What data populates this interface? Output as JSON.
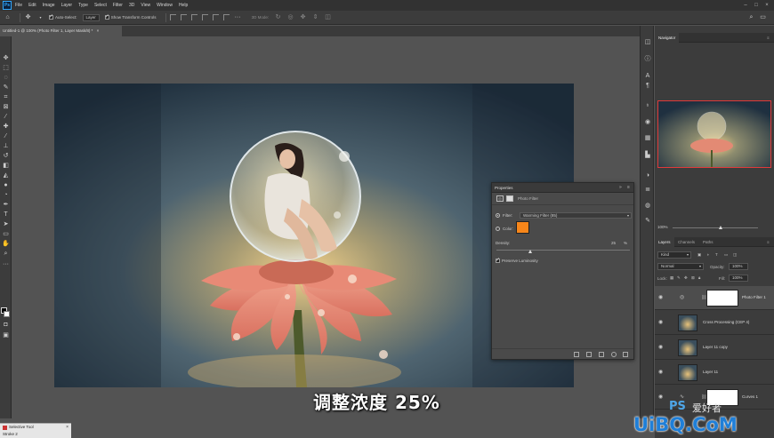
{
  "app": {
    "logo": "Ps",
    "menu": [
      "File",
      "Edit",
      "Image",
      "Layer",
      "Type",
      "Select",
      "Filter",
      "3D",
      "View",
      "Window",
      "Help"
    ]
  },
  "options_bar": {
    "auto_select_label": "Auto-Select:",
    "auto_select_value": "Layer",
    "transform_controls_label": "Show Transform Controls",
    "mode_3d_label": "3D Mode:"
  },
  "document_tab": {
    "title": "Untitled-1 @ 100% (Photo Filter 1, Layer Mask/8) *",
    "close": "×"
  },
  "subtitle": "调整浓度 25%",
  "properties": {
    "title": "Properties",
    "header_icons": "»",
    "menu_icon": "≡",
    "type_label": "Photo Filter",
    "filter_label": "Filter:",
    "filter_value": "Warming Filter (85)",
    "color_label": "Color:",
    "color_value": "#f7861a",
    "density_label": "Density:",
    "density_value": "25",
    "density_unit": "%",
    "density_fraction": 0.25,
    "preserve_label": "Preserve Luminosity",
    "preserve_checked": true,
    "filter_selected": true
  },
  "navigator": {
    "tab": "Navigator",
    "zoom": "100%"
  },
  "layers_panel": {
    "tabs": [
      "Layers",
      "Channels",
      "Paths"
    ],
    "kind_label": "Kind",
    "blend_mode": "Normal",
    "opacity_label": "Opacity:",
    "opacity_value": "100%",
    "lock_label": "Lock:",
    "fill_label": "Fill:",
    "fill_value": "100%",
    "layers": [
      {
        "name": "Photo Filter 1",
        "type": "adjustment",
        "selected": true
      },
      {
        "name": "Cross Processing (CEP 4)",
        "type": "image",
        "selected": false
      },
      {
        "name": "Layer 11 copy",
        "type": "image",
        "selected": false
      },
      {
        "name": "Layer 11",
        "type": "image",
        "selected": false
      },
      {
        "name": "Curves 1",
        "type": "adjustment",
        "selected": false
      }
    ]
  },
  "taskbar": {
    "item": "Selective Tool",
    "item2": "Stroke 2"
  },
  "watermark": {
    "ps": "PS",
    "cn": "爱好者",
    "site": "UiBQ.CoM"
  },
  "colors": {
    "accent_orange": "#f7861a",
    "nav_border": "#e03a3a",
    "ps_blue": "#31a8ff"
  }
}
